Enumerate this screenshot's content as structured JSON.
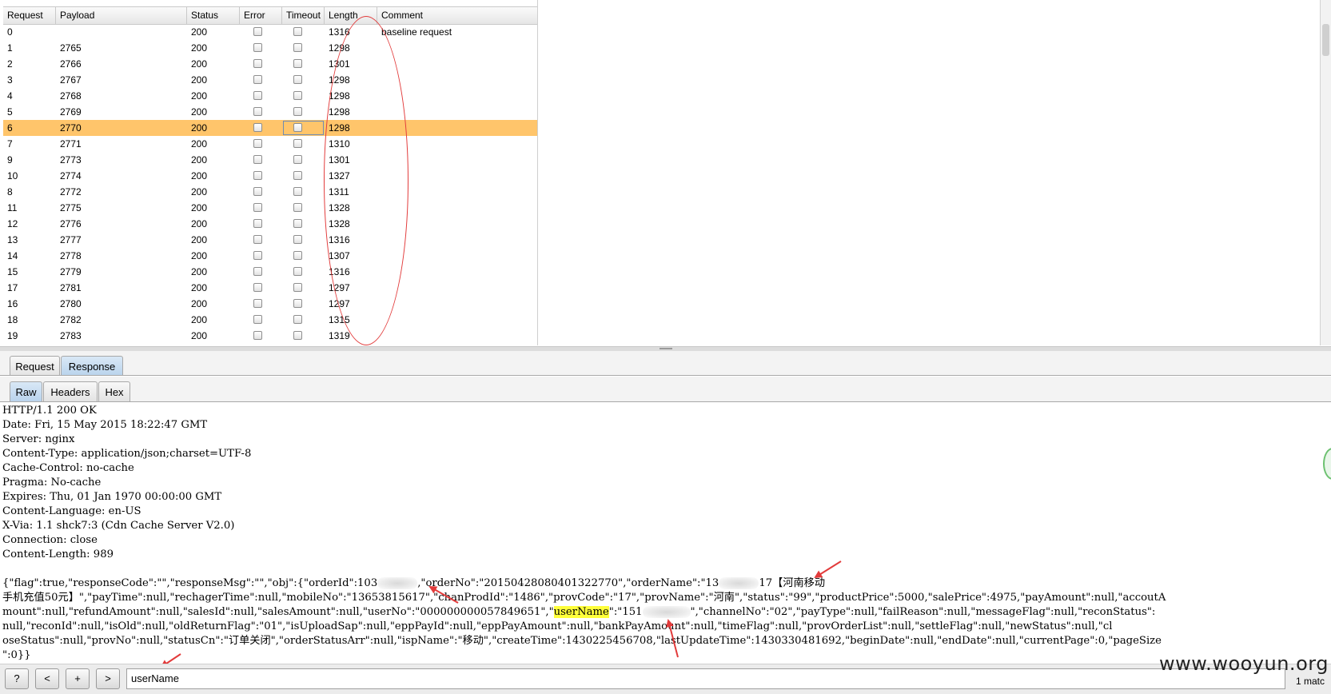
{
  "results": {
    "columns": [
      "Request",
      "Payload",
      "Status",
      "Error",
      "Timeout",
      "Length",
      "Comment"
    ],
    "rows": [
      {
        "request": "0",
        "payload": "",
        "status": "200",
        "length": "1316",
        "comment": "baseline request"
      },
      {
        "request": "1",
        "payload": "2765",
        "status": "200",
        "length": "1298",
        "comment": ""
      },
      {
        "request": "2",
        "payload": "2766",
        "status": "200",
        "length": "1301",
        "comment": ""
      },
      {
        "request": "3",
        "payload": "2767",
        "status": "200",
        "length": "1298",
        "comment": ""
      },
      {
        "request": "4",
        "payload": "2768",
        "status": "200",
        "length": "1298",
        "comment": ""
      },
      {
        "request": "5",
        "payload": "2769",
        "status": "200",
        "length": "1298",
        "comment": ""
      },
      {
        "request": "6",
        "payload": "2770",
        "status": "200",
        "length": "1298",
        "comment": ""
      },
      {
        "request": "7",
        "payload": "2771",
        "status": "200",
        "length": "1310",
        "comment": ""
      },
      {
        "request": "9",
        "payload": "2773",
        "status": "200",
        "length": "1301",
        "comment": ""
      },
      {
        "request": "10",
        "payload": "2774",
        "status": "200",
        "length": "1327",
        "comment": ""
      },
      {
        "request": "8",
        "payload": "2772",
        "status": "200",
        "length": "1311",
        "comment": ""
      },
      {
        "request": "11",
        "payload": "2775",
        "status": "200",
        "length": "1328",
        "comment": ""
      },
      {
        "request": "12",
        "payload": "2776",
        "status": "200",
        "length": "1328",
        "comment": ""
      },
      {
        "request": "13",
        "payload": "2777",
        "status": "200",
        "length": "1316",
        "comment": ""
      },
      {
        "request": "14",
        "payload": "2778",
        "status": "200",
        "length": "1307",
        "comment": ""
      },
      {
        "request": "15",
        "payload": "2779",
        "status": "200",
        "length": "1316",
        "comment": ""
      },
      {
        "request": "17",
        "payload": "2781",
        "status": "200",
        "length": "1297",
        "comment": ""
      },
      {
        "request": "16",
        "payload": "2780",
        "status": "200",
        "length": "1297",
        "comment": ""
      },
      {
        "request": "18",
        "payload": "2782",
        "status": "200",
        "length": "1315",
        "comment": ""
      },
      {
        "request": "19",
        "payload": "2783",
        "status": "200",
        "length": "1319",
        "comment": ""
      }
    ],
    "selected_row": 6,
    "selection_color": "#ffc56b"
  },
  "message_tabs": [
    "Request",
    "Response"
  ],
  "message_tab_active": "Response",
  "view_tabs": [
    "Raw",
    "Headers",
    "Hex"
  ],
  "view_tab_active": "Raw",
  "response": {
    "headers": [
      "HTTP/1.1 200 OK",
      "Date: Fri, 15 May 2015 18:22:47 GMT",
      "Server: nginx",
      "Content-Type: application/json;charset=UTF-8",
      "Cache-Control: no-cache",
      "Pragma: No-cache",
      "Expires: Thu, 01 Jan 1970 00:00:00 GMT",
      "Content-Language: en-US",
      "X-Via: 1.1 shck7:3 (Cdn Cache Server V2.0)",
      "Connection: close",
      "Content-Length: 989"
    ],
    "body": {
      "l1a": "{\"flag\":true,\"responseCode\":\"\",\"responseMsg\":\"\",\"obj\":{\"orderId\":103",
      "l1b": ",\"orderNo\":\"20150428080401322770\",\"orderName\":\"13",
      "l1c": "17【河南移动",
      "l2": "手机充值50元】\",\"payTime\":null,\"rechagerTime\":null,\"mobileNo\":\"13653815617\",\"chanProdId\":\"1486\",\"provCode\":\"17\",\"provName\":\"河南\",\"status\":\"99\",\"productPrice\":5000,\"salePrice\":4975,\"payAmount\":null,\"accoutA",
      "l3a": "mount\":null,\"refundAmount\":null,\"salesId\":null,\"salesAmount\":null,\"userNo\":\"000000000057849651\",\"",
      "l3hl": "userName",
      "l3b": "\":\"151",
      "l3c": "\",\"channelNo\":\"02\",\"payType\":null,\"failReason\":null,\"messageFlag\":null,\"reconStatus\":",
      "l4": "null,\"reconId\":null,\"isOld\":null,\"oldReturnFlag\":\"01\",\"isUploadSap\":null,\"eppPayId\":null,\"eppPayAmount\":null,\"bankPayAmount\":null,\"timeFlag\":null,\"provOrderList\":null,\"settleFlag\":null,\"newStatus\":null,\"cl",
      "l5": "oseStatus\":null,\"provNo\":null,\"statusCn\":\"订单关闭\",\"orderStatusArr\":null,\"ispName\":\"移动\",\"createTime\":1430225456708,\"lastUpdateTime\":1430330481692,\"beginDate\":null,\"endDate\":null,\"currentPage\":0,\"pageSize",
      "l6": "\":0}}"
    }
  },
  "search": {
    "help_label": "?",
    "prev_label": "<",
    "add_label": "+",
    "next_label": ">",
    "value": "userName",
    "matches": "1 matc"
  },
  "watermark": "www.wooyun.org",
  "colors": {
    "annotation_red": "#e23b3b",
    "highlight_yellow": "#ffff3a",
    "active_tab": "#b9d3ec"
  }
}
